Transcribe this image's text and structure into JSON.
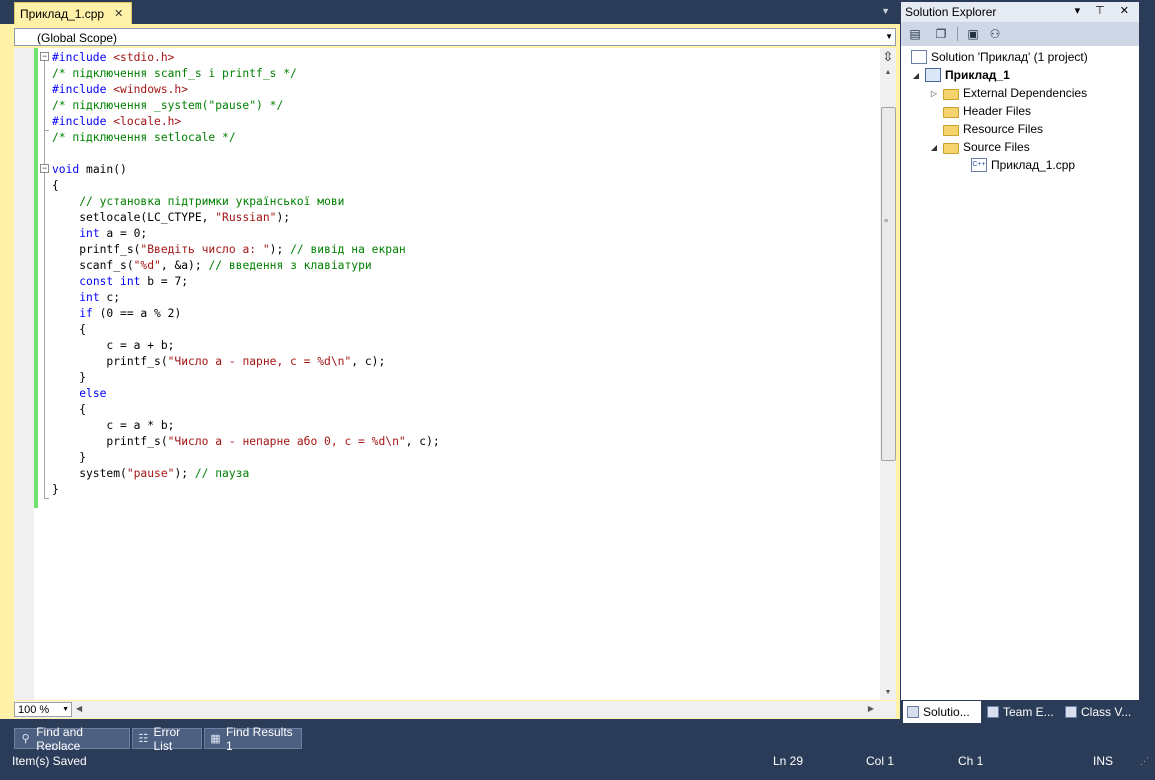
{
  "editor": {
    "tab_label": "Приклад_1.cpp",
    "tab_close": "✕",
    "scope_label": "(Global Scope)",
    "zoom": "100 %",
    "code_lines": [
      [
        [
          "pp",
          "#include "
        ],
        [
          "st",
          "<stdio.h>"
        ]
      ],
      [
        [
          "cm",
          "/* підключення scanf_s і printf_s */"
        ]
      ],
      [
        [
          "pp",
          "#include "
        ],
        [
          "st",
          "<windows.h>"
        ]
      ],
      [
        [
          "cm",
          "/* підключення _system(\"pause\") */"
        ]
      ],
      [
        [
          "pp",
          "#include "
        ],
        [
          "st",
          "<locale.h>"
        ]
      ],
      [
        [
          "cm",
          "/* підключення setlocale */"
        ]
      ],
      [
        [
          "tx",
          ""
        ]
      ],
      [
        [
          "kw",
          "void"
        ],
        [
          "tx",
          " main()"
        ]
      ],
      [
        [
          "tx",
          "{"
        ]
      ],
      [
        [
          "tx",
          "    "
        ],
        [
          "cm",
          "// установка підтримки української мови"
        ]
      ],
      [
        [
          "tx",
          "    setlocale(LC_CTYPE, "
        ],
        [
          "st",
          "\"Russian\""
        ],
        [
          "tx",
          ");"
        ]
      ],
      [
        [
          "tx",
          "    "
        ],
        [
          "kw",
          "int"
        ],
        [
          "tx",
          " a = 0;"
        ]
      ],
      [
        [
          "tx",
          "    printf_s("
        ],
        [
          "st",
          "\"Введіть число а: \""
        ],
        [
          "tx",
          "); "
        ],
        [
          "cm",
          "// вивід на екран"
        ]
      ],
      [
        [
          "tx",
          "    scanf_s("
        ],
        [
          "st",
          "\"%d\""
        ],
        [
          "tx",
          ", &a); "
        ],
        [
          "cm",
          "// введення з клавіатури"
        ]
      ],
      [
        [
          "tx",
          "    "
        ],
        [
          "kw",
          "const"
        ],
        [
          "tx",
          " "
        ],
        [
          "kw",
          "int"
        ],
        [
          "tx",
          " b = 7;"
        ]
      ],
      [
        [
          "tx",
          "    "
        ],
        [
          "kw",
          "int"
        ],
        [
          "tx",
          " c;"
        ]
      ],
      [
        [
          "tx",
          "    "
        ],
        [
          "kw",
          "if"
        ],
        [
          "tx",
          " (0 == a % 2)"
        ]
      ],
      [
        [
          "tx",
          "    {"
        ]
      ],
      [
        [
          "tx",
          "        c = a + b;"
        ]
      ],
      [
        [
          "tx",
          "        printf_s("
        ],
        [
          "st",
          "\"Число а - парне, с = %d\\n\""
        ],
        [
          "tx",
          ", c);"
        ]
      ],
      [
        [
          "tx",
          "    }"
        ]
      ],
      [
        [
          "tx",
          "    "
        ],
        [
          "kw",
          "else"
        ]
      ],
      [
        [
          "tx",
          "    {"
        ]
      ],
      [
        [
          "tx",
          "        c = a * b;"
        ]
      ],
      [
        [
          "tx",
          "        printf_s("
        ],
        [
          "st",
          "\"Число а - непарне або 0, с = %d\\n\""
        ],
        [
          "tx",
          ", c);"
        ]
      ],
      [
        [
          "tx",
          "    }"
        ]
      ],
      [
        [
          "tx",
          "    system("
        ],
        [
          "st",
          "\"pause\""
        ],
        [
          "tx",
          "); "
        ],
        [
          "cm",
          "// пауза"
        ]
      ],
      [
        [
          "tx",
          "}"
        ]
      ]
    ]
  },
  "solution_explorer": {
    "title": "Solution Explorer",
    "title_buttons": "▾ ⊤ ✕",
    "tree": {
      "solution": "Solution 'Приклад' (1 project)",
      "project": "Приклад_1",
      "external_deps": "External Dependencies",
      "header_files": "Header Files",
      "resource_files": "Resource Files",
      "source_files": "Source Files",
      "source_file": "Приклад_1.cpp"
    },
    "tabs": [
      "Solutio...",
      "Team E...",
      "Class V..."
    ]
  },
  "bottom_tabs": [
    "Find and Replace",
    "Error List",
    "Find Results 1"
  ],
  "status": {
    "message": "Item(s) Saved",
    "line": "Ln 29",
    "col": "Col 1",
    "ch": "Ch 1",
    "mode": "INS"
  },
  "colors": {
    "chrome": "#2b3c59",
    "active_tab": "#fff1a8",
    "keyword": "#0000ff",
    "comment": "#008000",
    "string": "#a31515",
    "change_bar": "#6fe36f"
  }
}
